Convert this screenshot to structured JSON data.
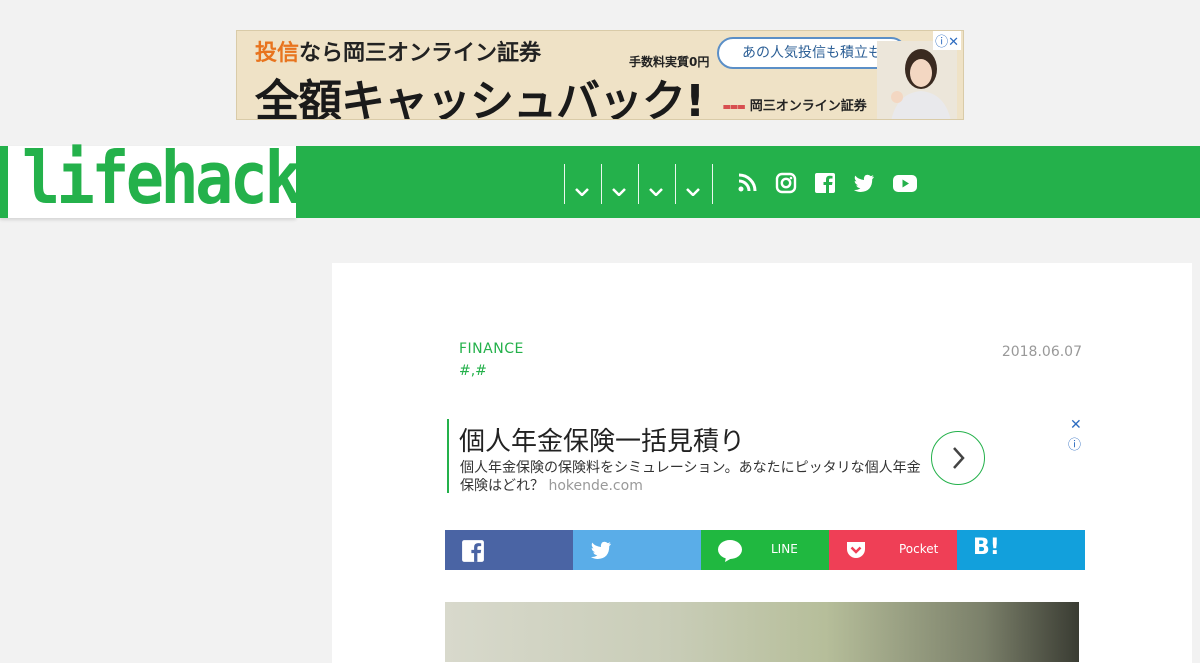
{
  "top_ad": {
    "line1_accent": "投信",
    "line1_rest": "なら岡三オンライン証券",
    "line2": "全額キャッシュバック!",
    "fee_label": "手数料実質0円",
    "bubble": "あの人気投信も積立も",
    "brand": "岡三オンライン証券",
    "brand_mark": "⩶",
    "adchoices": "ⓘ✕"
  },
  "header": {
    "logo": "lifehacker",
    "nav_dropdowns": [
      "",
      "",
      "",
      ""
    ],
    "social_icons": [
      "rss-icon",
      "instagram-icon",
      "facebook-icon",
      "twitter-icon",
      "youtube-icon"
    ]
  },
  "article": {
    "category": "FINANCE",
    "tags": "#,#",
    "date": "2018.06.07"
  },
  "inline_ad": {
    "title": "個人年金保険一括見積り",
    "description": "個人年金保険の保険料をシミュレーション。あなたにピッタリな個人年金保険はどれ？",
    "domain": "hokende.com",
    "close": "✕",
    "info": "ⓘ"
  },
  "share": {
    "line_label": "LINE",
    "pocket_label": "Pocket",
    "hatena_label": "B!"
  },
  "colors": {
    "brand_green": "#24b14b",
    "facebook": "#4a64a4",
    "twitter": "#5aade8",
    "line": "#20b840",
    "pocket": "#ef3f56",
    "hatena": "#12a0dc"
  }
}
